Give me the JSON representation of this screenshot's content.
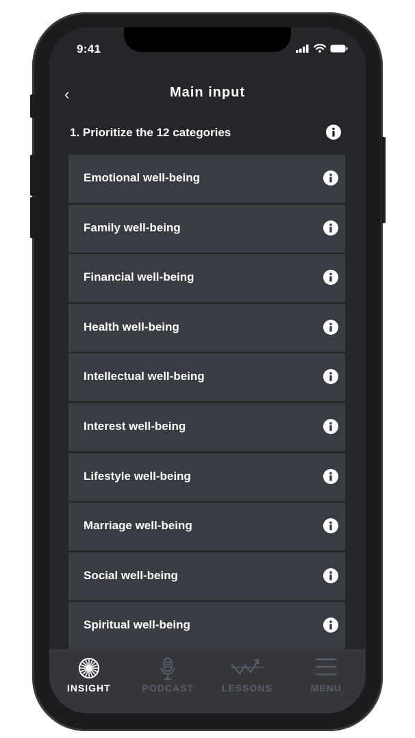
{
  "status_bar": {
    "time": "9:41"
  },
  "header": {
    "back_label": "‹",
    "title": "Main input"
  },
  "section": {
    "heading": "1. Prioritize the 12 categories"
  },
  "categories": [
    {
      "label": "Emotional well-being"
    },
    {
      "label": "Family well-being"
    },
    {
      "label": "Financial well-being"
    },
    {
      "label": "Health well-being"
    },
    {
      "label": "Intellectual well-being"
    },
    {
      "label": "Interest well-being"
    },
    {
      "label": "Lifestyle well-being"
    },
    {
      "label": "Marriage well-being"
    },
    {
      "label": "Social well-being"
    },
    {
      "label": "Spiritual well-being"
    }
  ],
  "tab_bar": {
    "tabs": [
      {
        "label": "INSIGHT",
        "icon": "insight-sunburst-icon",
        "active": true
      },
      {
        "label": "PODCAST",
        "icon": "microphone-icon",
        "active": false
      },
      {
        "label": "LESSONS",
        "icon": "lessons-chart-icon",
        "active": false
      },
      {
        "label": "MENU",
        "icon": "hamburger-menu-icon",
        "active": false
      }
    ]
  },
  "colors": {
    "background": "#252629",
    "list_item": "#3a3c43",
    "tab_bar": "#35373d",
    "tab_inactive": "#5b5e66",
    "text": "#ffffff"
  }
}
